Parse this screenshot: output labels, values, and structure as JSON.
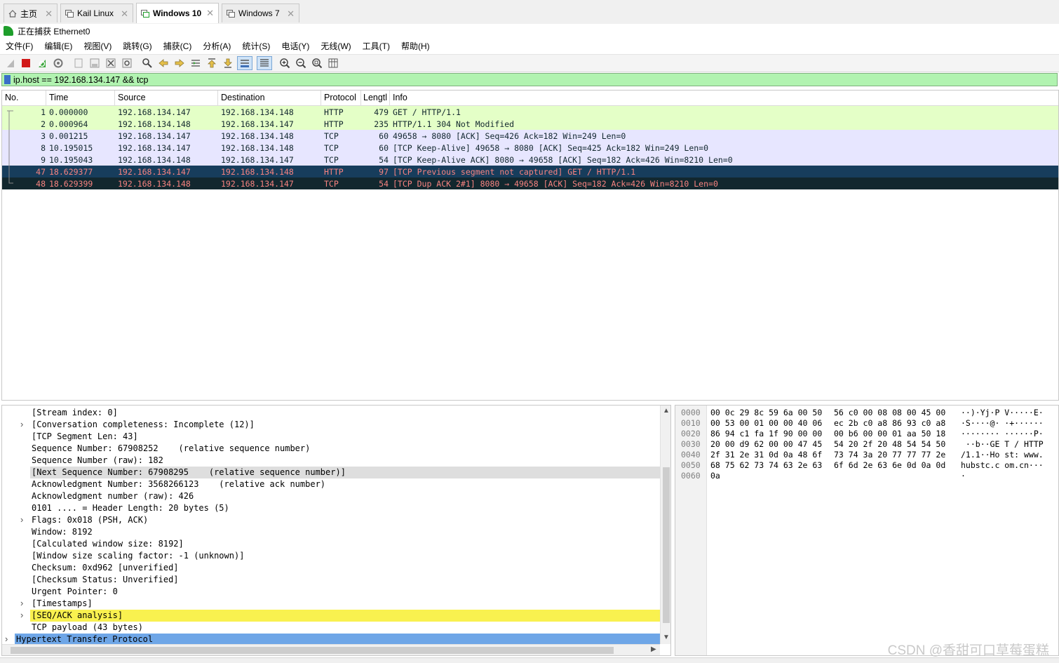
{
  "tabs": [
    {
      "label": "主页",
      "icon": "home-icon",
      "active": false
    },
    {
      "label": "Kail Linux",
      "icon": "vm-icon",
      "active": false
    },
    {
      "label": "Windows 10",
      "icon": "vm-icon",
      "active": true
    },
    {
      "label": "Windows 7",
      "icon": "vm-icon",
      "active": false
    }
  ],
  "capture_status": "正在捕获 Ethernet0",
  "menu": [
    "文件(F)",
    "编辑(E)",
    "视图(V)",
    "跳转(G)",
    "捕获(C)",
    "分析(A)",
    "统计(S)",
    "电话(Y)",
    "无线(W)",
    "工具(T)",
    "帮助(H)"
  ],
  "toolbar": [
    "start-capture-icon",
    "stop-capture-icon",
    "restart-capture-icon",
    "capture-options-icon",
    "open-file-icon",
    "save-file-icon",
    "close-file-icon",
    "reload-file-icon",
    "find-packet-icon",
    "go-back-icon",
    "go-forward-icon",
    "go-to-packet-icon",
    "go-first-icon",
    "go-last-icon",
    "autoscroll-icon",
    "colorize-icon",
    "zoom-in-icon",
    "zoom-out-icon",
    "normal-size-icon",
    "resize-columns-icon"
  ],
  "filter": {
    "value": "ip.host == 192.168.134.147 && tcp"
  },
  "packet_list": {
    "columns": [
      "No.",
      "Time",
      "Source",
      "Destination",
      "Protocol",
      "Lengtl",
      "Info"
    ],
    "rows": [
      {
        "no": "1",
        "time": "0.000000",
        "src": "192.168.134.147",
        "dst": "192.168.134.148",
        "proto": "HTTP",
        "len": "479",
        "info": "GET / HTTP/1.1",
        "bg": "#e4ffc7",
        "fg": "#12272e"
      },
      {
        "no": "2",
        "time": "0.000964",
        "src": "192.168.134.148",
        "dst": "192.168.134.147",
        "proto": "HTTP",
        "len": "235",
        "info": "HTTP/1.1 304 Not Modified",
        "bg": "#e4ffc7",
        "fg": "#12272e"
      },
      {
        "no": "3",
        "time": "0.001215",
        "src": "192.168.134.147",
        "dst": "192.168.134.148",
        "proto": "TCP",
        "len": "60",
        "info": "49658 → 8080 [ACK] Seq=426 Ack=182 Win=249 Len=0",
        "bg": "#e7e6ff",
        "fg": "#12272e"
      },
      {
        "no": "8",
        "time": "10.195015",
        "src": "192.168.134.147",
        "dst": "192.168.134.148",
        "proto": "TCP",
        "len": "60",
        "info": "[TCP Keep-Alive] 49658 → 8080 [ACK] Seq=425 Ack=182 Win=249 Len=0",
        "bg": "#e7e6ff",
        "fg": "#12272e"
      },
      {
        "no": "9",
        "time": "10.195043",
        "src": "192.168.134.148",
        "dst": "192.168.134.147",
        "proto": "TCP",
        "len": "54",
        "info": "[TCP Keep-Alive ACK] 8080 → 49658 [ACK] Seq=182 Ack=426 Win=8210 Len=0",
        "bg": "#e7e6ff",
        "fg": "#12272e"
      },
      {
        "no": "47",
        "time": "18.629377",
        "src": "192.168.134.147",
        "dst": "192.168.134.148",
        "proto": "HTTP",
        "len": "97",
        "info": "[TCP Previous segment not captured] GET / HTTP/1.1",
        "bg": "#173d5c",
        "fg": "#f78380"
      },
      {
        "no": "48",
        "time": "18.629399",
        "src": "192.168.134.148",
        "dst": "192.168.134.147",
        "proto": "TCP",
        "len": "54",
        "info": "[TCP Dup ACK 2#1] 8080 → 49658 [ACK] Seq=182 Ack=426 Win=8210 Len=0",
        "bg": "#12272e",
        "fg": "#f78380"
      }
    ]
  },
  "details": {
    "rows": [
      {
        "text": "[Stream index: 0]",
        "expandable": false,
        "hl": ""
      },
      {
        "text": "[Conversation completeness: Incomplete (12)]",
        "expandable": true,
        "hl": ""
      },
      {
        "text": "[TCP Segment Len: 43]",
        "expandable": false,
        "hl": ""
      },
      {
        "text": "Sequence Number: 67908252    (relative sequence number)",
        "expandable": false,
        "hl": ""
      },
      {
        "text": "Sequence Number (raw): 182",
        "expandable": false,
        "hl": ""
      },
      {
        "text": "[Next Sequence Number: 67908295    (relative sequence number)]",
        "expandable": false,
        "hl": "#dedede"
      },
      {
        "text": "Acknowledgment Number: 3568266123    (relative ack number)",
        "expandable": false,
        "hl": ""
      },
      {
        "text": "Acknowledgment number (raw): 426",
        "expandable": false,
        "hl": ""
      },
      {
        "text": "0101 .... = Header Length: 20 bytes (5)",
        "expandable": false,
        "hl": ""
      },
      {
        "text": "Flags: 0x018 (PSH, ACK)",
        "expandable": true,
        "hl": ""
      },
      {
        "text": "Window: 8192",
        "expandable": false,
        "hl": ""
      },
      {
        "text": "[Calculated window size: 8192]",
        "expandable": false,
        "hl": ""
      },
      {
        "text": "[Window size scaling factor: -1 (unknown)]",
        "expandable": false,
        "hl": ""
      },
      {
        "text": "Checksum: 0xd962 [unverified]",
        "expandable": false,
        "hl": ""
      },
      {
        "text": "[Checksum Status: Unverified]",
        "expandable": false,
        "hl": ""
      },
      {
        "text": "Urgent Pointer: 0",
        "expandable": false,
        "hl": ""
      },
      {
        "text": "[Timestamps]",
        "expandable": true,
        "hl": ""
      },
      {
        "text": "[SEQ/ACK analysis]",
        "expandable": true,
        "hl": "#f9f14f"
      },
      {
        "text": "TCP payload (43 bytes)",
        "expandable": false,
        "hl": ""
      },
      {
        "text": "Hypertext Transfer Protocol",
        "expandable": true,
        "hl": "#6ea6e7",
        "top_level": true
      }
    ]
  },
  "bytes": {
    "rows": [
      {
        "offset": "0000",
        "hex1": "00 0c 29 8c 59 6a 00 50",
        "hex2": "56 c0 00 08 08 00 45 00",
        "ascii": "··)·Yj·P V·····E·"
      },
      {
        "offset": "0010",
        "hex1": "00 53 00 01 00 00 40 06",
        "hex2": "ec 2b c0 a8 86 93 c0 a8",
        "ascii": "·S····@· ·+······"
      },
      {
        "offset": "0020",
        "hex1": "86 94 c1 fa 1f 90 00 00",
        "hex2": "00 b6 00 00 01 aa 50 18",
        "ascii": "········ ······P·"
      },
      {
        "offset": "0030",
        "hex1": "20 00 d9 62 00 00 47 45",
        "hex2": "54 20 2f 20 48 54 54 50",
        "ascii": " ··b··GE T / HTTP"
      },
      {
        "offset": "0040",
        "hex1": "2f 31 2e 31 0d 0a 48 6f",
        "hex2": "73 74 3a 20 77 77 77 2e",
        "ascii": "/1.1··Ho st: www."
      },
      {
        "offset": "0050",
        "hex1": "68 75 62 73 74 63 2e 63",
        "hex2": "6f 6d 2e 63 6e 0d 0a 0d",
        "ascii": "hubstc.c om.cn···"
      },
      {
        "offset": "0060",
        "hex1": "0a",
        "hex2": "",
        "ascii": "·"
      }
    ]
  },
  "watermark": "CSDN @香甜可口草莓蛋糕"
}
